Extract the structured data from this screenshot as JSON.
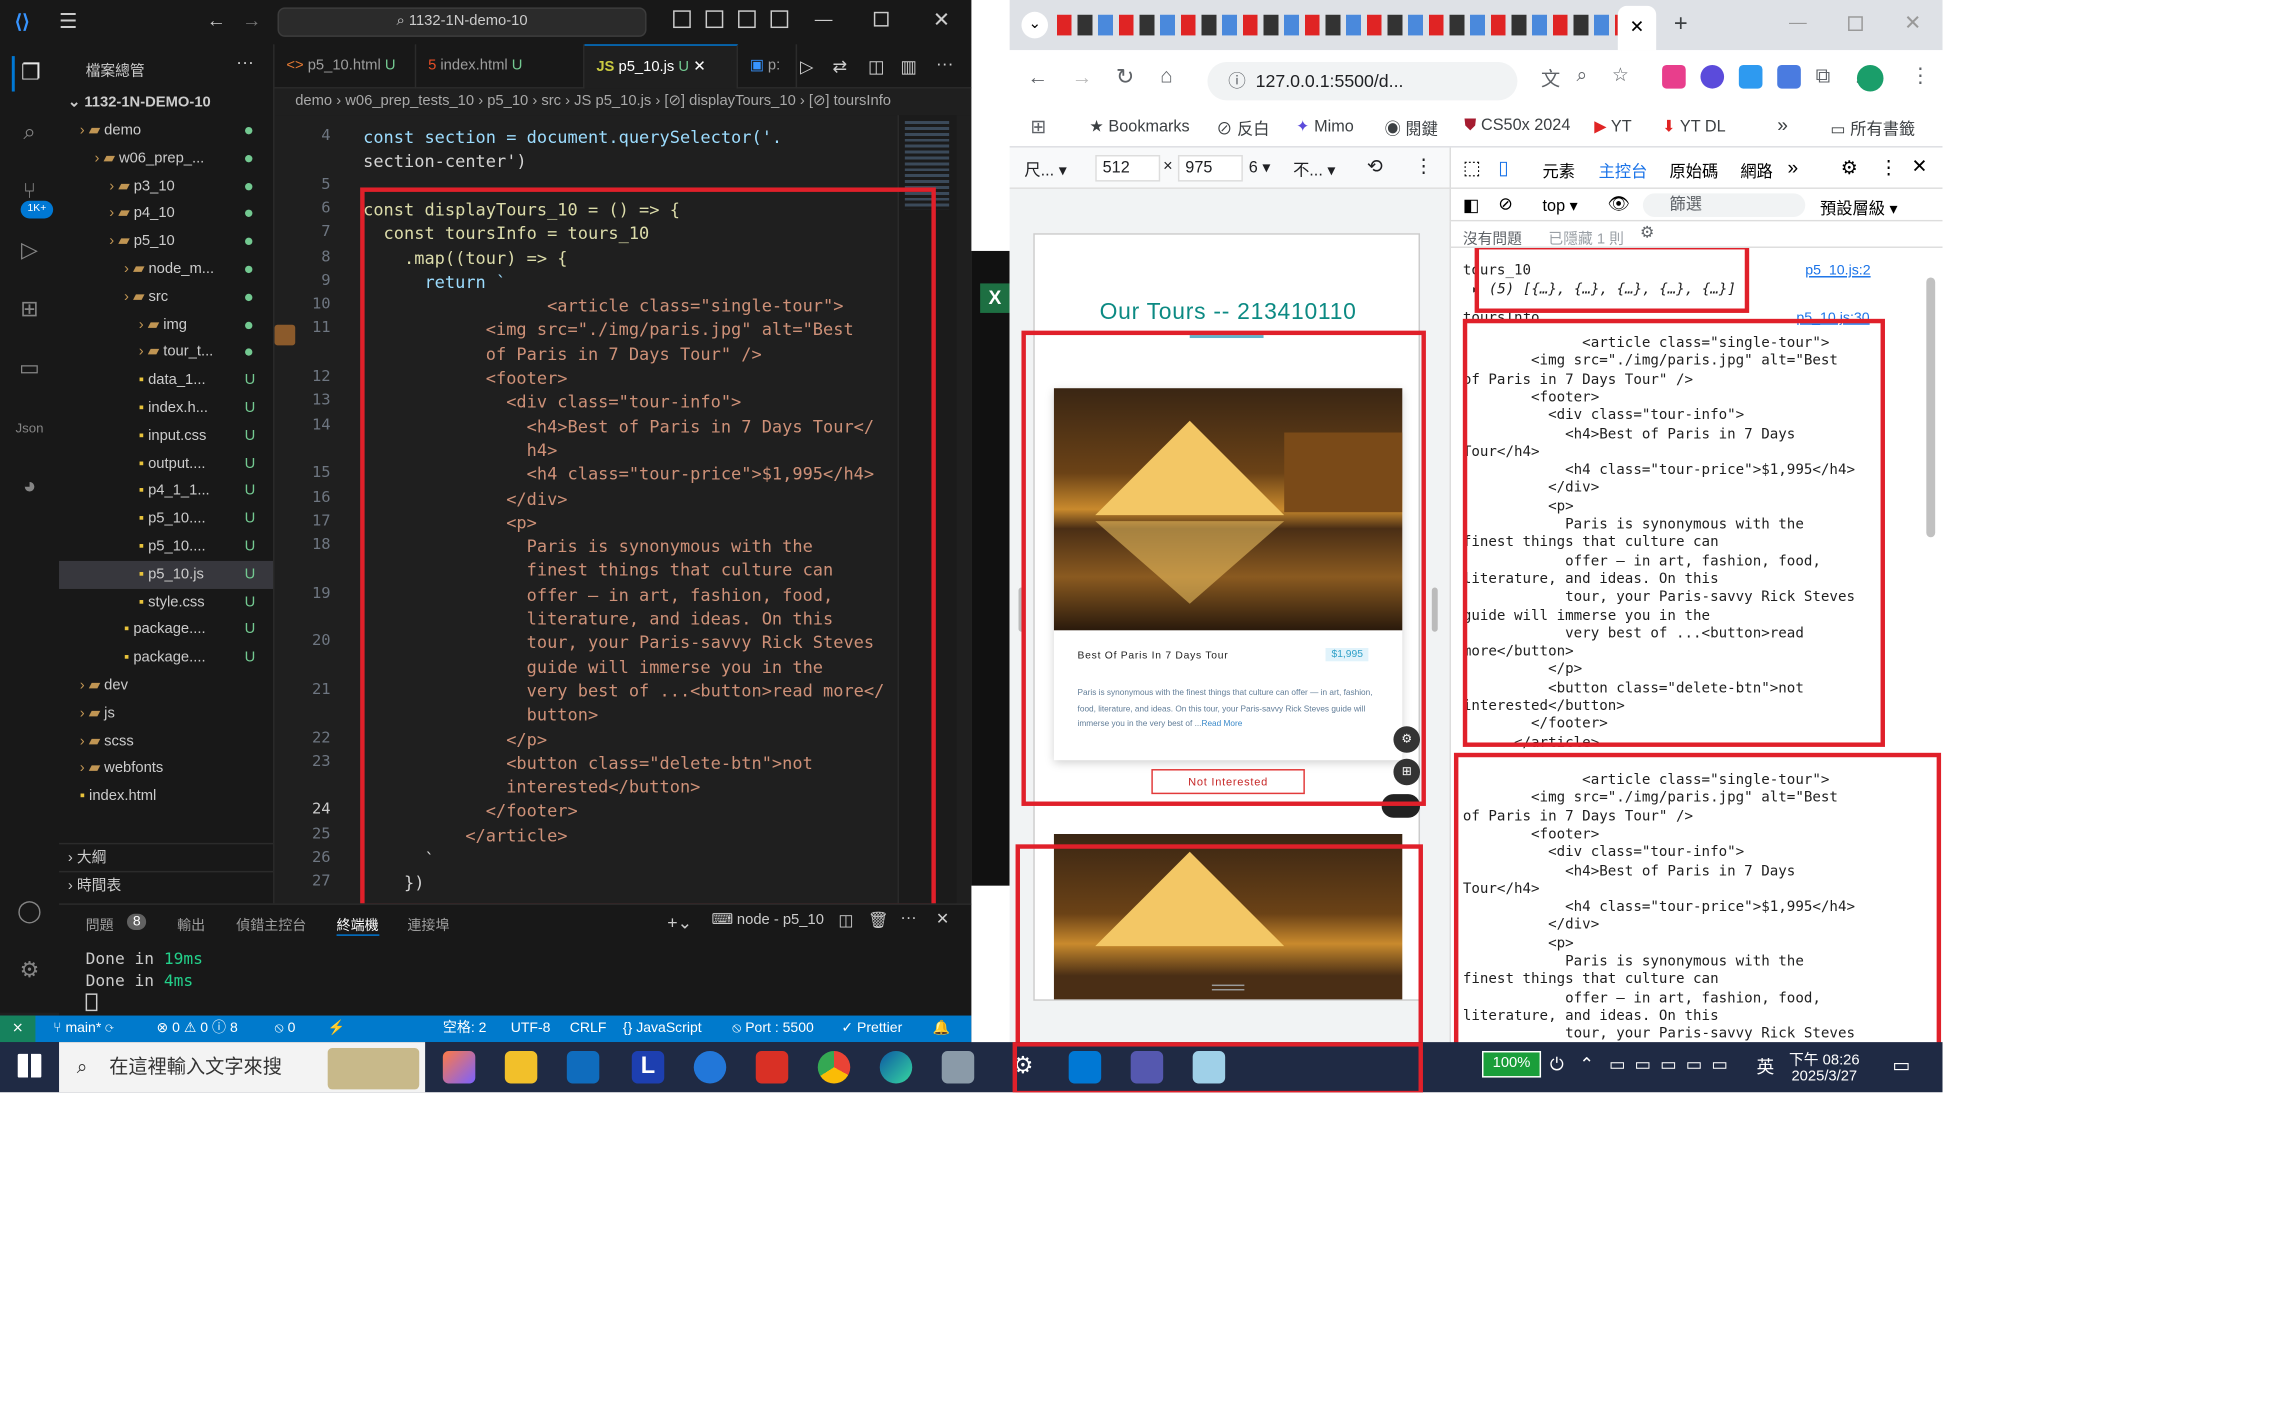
{
  "vscode": {
    "search_text": "1132-1N-demo-10",
    "explorer_title": "檔案總管",
    "project_root": "1132-1N-DEMO-10",
    "tree": [
      {
        "label": "demo",
        "badge": "dot"
      },
      {
        "label": "w06_prep_...",
        "badge": "dot"
      },
      {
        "label": "p3_10",
        "badge": "dot"
      },
      {
        "label": "p4_10",
        "badge": "dot"
      },
      {
        "label": "p5_10",
        "badge": "dot"
      },
      {
        "label": "node_m...",
        "badge": "dot"
      },
      {
        "label": "src",
        "badge": "dot"
      },
      {
        "label": "img",
        "badge": "dot"
      },
      {
        "label": "tour_t...",
        "badge": "dot"
      },
      {
        "label": "data_1...",
        "badge": "U"
      },
      {
        "label": "index.h...",
        "badge": "U"
      },
      {
        "label": "input.css",
        "badge": "U"
      },
      {
        "label": "output....",
        "badge": "U"
      },
      {
        "label": "p4_1_1...",
        "badge": "U"
      },
      {
        "label": "p5_10....",
        "badge": "U"
      },
      {
        "label": "p5_10....",
        "badge": "U"
      },
      {
        "label": "p5_10.js",
        "badge": "U"
      },
      {
        "label": "style.css",
        "badge": "U"
      },
      {
        "label": "package....",
        "badge": "U"
      },
      {
        "label": "package....",
        "badge": "U"
      },
      {
        "label": "dev",
        "badge": ""
      },
      {
        "label": "js",
        "badge": ""
      },
      {
        "label": "scss",
        "badge": ""
      },
      {
        "label": "webfonts",
        "badge": ""
      },
      {
        "label": "index.html",
        "badge": ""
      }
    ],
    "outline_label": "大綱",
    "timeline_label": "時間表",
    "tabs": [
      {
        "label": "p5_10.html",
        "badge": "U"
      },
      {
        "label": "index.html",
        "badge": "U"
      },
      {
        "label": "p5_10.js",
        "badge": "U"
      },
      {
        "label": "p:",
        "badge": ""
      }
    ],
    "breadcrumb": "demo › w06_prep_tests_10 › p5_10 › src › JS p5_10.js › [⊘] displayTours_10 › [⊘] toursInfo",
    "line_numbers": [
      "4",
      "",
      "5",
      "6",
      "7",
      "8",
      "9",
      "10",
      "11",
      "",
      "12",
      "13",
      "14",
      "",
      "15",
      "16",
      "17",
      "18",
      "",
      "19",
      "",
      "20",
      "",
      "21",
      "",
      "22",
      "23",
      "",
      "24",
      "25",
      "26",
      "27"
    ],
    "code_lines": [
      "const section = document.querySelector('.",
      "section-center')",
      "",
      "const displayTours_10 = () => {",
      "  const toursInfo = tours_10",
      "    .map((tour) => {",
      "      return `",
      "                  <article class=\"single-tour\">",
      "            <img src=\"./img/paris.jpg\" alt=\"Best",
      "            of Paris in 7 Days Tour\" />",
      "            <footer>",
      "              <div class=\"tour-info\">",
      "                <h4>Best of Paris in 7 Days Tour</",
      "                h4>",
      "                <h4 class=\"tour-price\">$1,995</h4>",
      "              </div>",
      "              <p>",
      "                Paris is synonymous with the",
      "                finest things that culture can",
      "                offer — in art, fashion, food,",
      "                literature, and ideas. On this",
      "                tour, your Paris-savvy Rick Steves",
      "                guide will immerse you in the",
      "                very best of ...<button>read more</",
      "                button>",
      "              </p>",
      "              <button class=\"delete-btn\">not",
      "              interested</button>",
      "            </footer>",
      "          </article>",
      "      `",
      "    })"
    ],
    "panel_tabs": [
      "問題",
      "8",
      "輸出",
      "偵錯主控台",
      "終端機",
      "連接埠"
    ],
    "terminal_name": "node - p5_10",
    "terminal_lines": [
      "Done in 19ms",
      "Done in 4ms"
    ],
    "status": {
      "branch": "main*",
      "errors": "0",
      "warnings": "0",
      "info": "8",
      "ports": "0",
      "spaces": "空格: 2",
      "encoding": "UTF-8",
      "eol": "CRLF",
      "language": "JavaScript",
      "port": "Port : 5500",
      "prettier": "Prettier"
    }
  },
  "chrome": {
    "url": "127.0.0.1:5500/d...",
    "bookmarks": [
      "Bookmarks",
      "反白",
      "Mimo",
      "閱鍵",
      "CS50x 2024",
      "YT",
      "YT DL",
      "所有書籤"
    ],
    "device_bar": {
      "device": "尺...",
      "width": "512",
      "height": "975",
      "zoom": "6",
      "throttle": "不..."
    },
    "devtools_tabs": [
      "元素",
      "主控台",
      "原始碼",
      "網路"
    ],
    "context": "top",
    "filter_placeholder": "篩選",
    "levels": "預設層級",
    "no_issues": "沒有問題",
    "hidden": "已隱藏 1 則",
    "page": {
      "title": "Our Tours -- 213410110",
      "card_title": "Best Of Paris In 7 Days Tour",
      "card_price": "$1,995",
      "card_text": "Paris is synonymous with the finest things that culture can offer — in art, fashion, food, literature, and ideas. On this tour, your Paris-savvy Rick Steves guide will immerse you in the very best of ...",
      "read_more": "Read More",
      "not_interested": "Not Interested"
    },
    "console": {
      "log1_label": "tours_10",
      "log1_src": "p5_10.js:2",
      "log1_value": "▸ (5) [{…}, {…}, {…}, {…}, {…}]",
      "log2_label": "toursInfo",
      "log2_src": "p5_10.js:30",
      "block_lines": [
        "              <article class=\"single-tour\">",
        "        <img src=\"./img/paris.jpg\" alt=\"Best",
        "of Paris in 7 Days Tour\" />",
        "        <footer>",
        "          <div class=\"tour-info\">",
        "            <h4>Best of Paris in 7 Days",
        "Tour</h4>",
        "            <h4 class=\"tour-price\">$1,995</h4>",
        "          </div>",
        "          <p>",
        "            Paris is synonymous with the",
        "finest things that culture can",
        "            offer — in art, fashion, food,",
        "literature, and ideas. On this",
        "            tour, your Paris-savvy Rick Steves",
        "guide will immerse you in the",
        "            very best of ...<button>read",
        "more</button>",
        "          </p>",
        "          <button class=\"delete-btn\">not",
        "interested</button>",
        "        </footer>",
        "      </article>"
      ]
    }
  },
  "taskbar": {
    "search_placeholder": "在這裡輸入文字來搜",
    "battery": "100%",
    "ime": "英",
    "time": "下午 08:26",
    "date": "2025/3/27"
  }
}
